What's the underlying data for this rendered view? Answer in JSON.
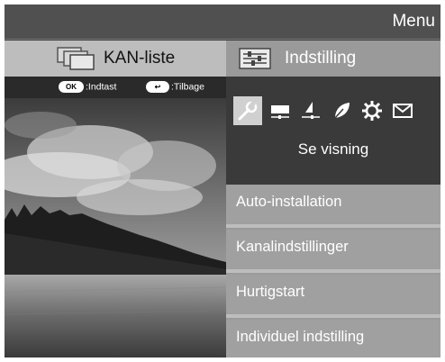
{
  "header": {
    "menu_label": "Menu"
  },
  "tabs": [
    {
      "label": "KAN-liste",
      "icon": "channel-list-icon"
    },
    {
      "label": "Indstilling",
      "icon": "settings-sliders-icon"
    }
  ],
  "hints": [
    {
      "key": "OK",
      "text": ":Indtast"
    },
    {
      "key": "↩",
      "text": ":Tilbage"
    }
  ],
  "settings": {
    "icons": [
      "wrench-icon",
      "picture-icon",
      "speaker-icon",
      "leaf-icon",
      "gear-icon",
      "envelope-icon"
    ],
    "selected_icon": "wrench-icon",
    "subtitle": "Se visning"
  },
  "menu_items": [
    {
      "label": "Auto-installation"
    },
    {
      "label": "Kanalindstillinger"
    },
    {
      "label": "Hurtigstart"
    },
    {
      "label": "Individuel indstilling"
    }
  ],
  "colors": {
    "frame": "#3c3c3c",
    "active_tab": "#bdbdbd",
    "menu_item": "#a0a0a0"
  }
}
